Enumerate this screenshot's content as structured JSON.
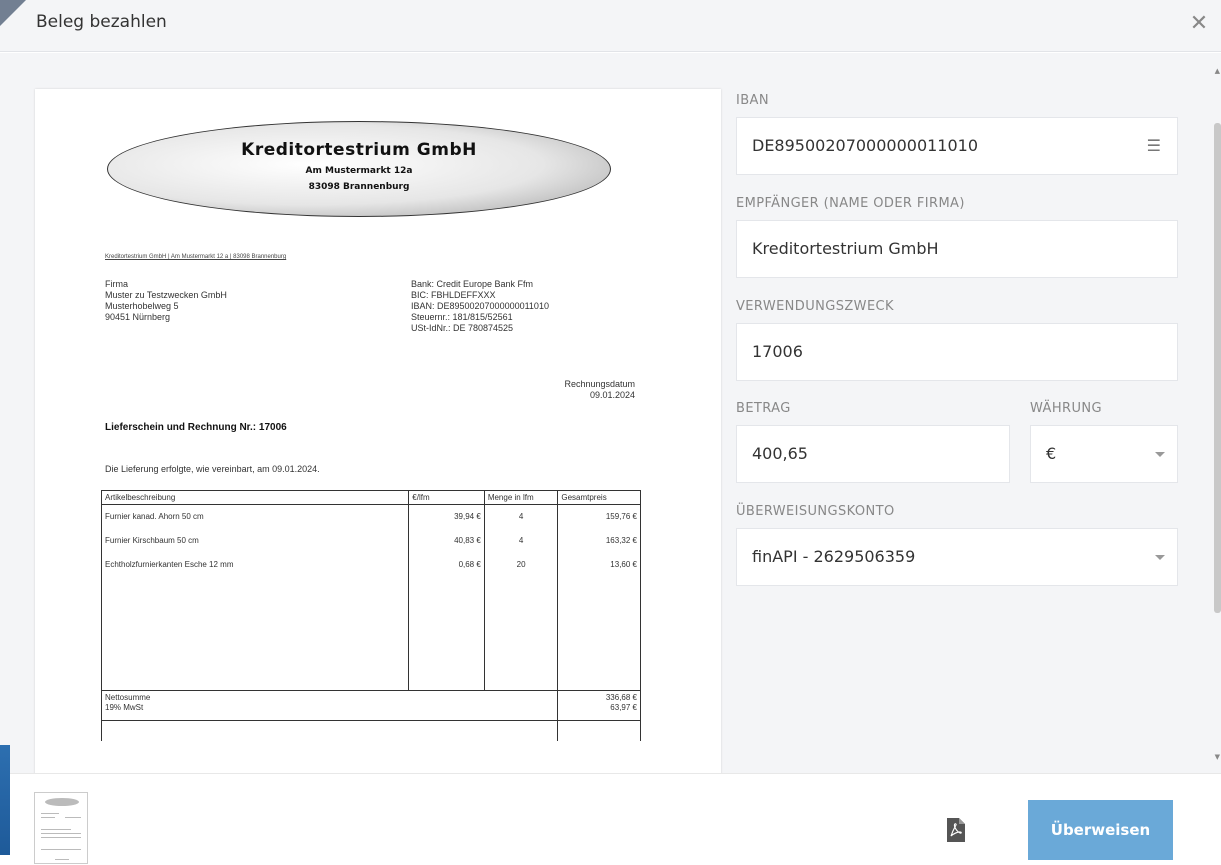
{
  "dialog": {
    "title": "Beleg bezahlen",
    "close_icon": "close-icon"
  },
  "document": {
    "logo": {
      "company": "Kreditortestrium GmbH",
      "street": "Am Mustermarkt 12a",
      "city": "83098 Brannenburg"
    },
    "sender_line": "Kreditortestrium GmbH | Am Mustermarkt 12 a | 83098 Brannenburg",
    "recipient": [
      "Firma",
      "Muster zu Testzwecken GmbH",
      "Musterhobelweg 5",
      "90451 Nürnberg"
    ],
    "bank": [
      "Bank: Credit Europe Bank Ffm",
      "BIC: FBHLDEFFXXX",
      "IBAN: DE89500207000000011010",
      "Steuernr.: 181/815/52561",
      "USt-IdNr.: DE 780874525"
    ],
    "date_label": "Rechnungsdatum",
    "date_value": "09.01.2024",
    "heading": "Lieferschein und Rechnung Nr.: 17006",
    "delivery_note": "Die Lieferung erfolgte, wie vereinbart, am 09.01.2024.",
    "table": {
      "headers": [
        "Artikelbeschreibung",
        "€/lfm",
        "Menge in lfm",
        "Gesamtpreis"
      ],
      "rows": [
        [
          "Furnier kanad. Ahorn 50 cm",
          "39,94 €",
          "4",
          "159,76 €"
        ],
        [
          "Furnier Kirschbaum 50 cm",
          "40,83 €",
          "4",
          "163,32 €"
        ],
        [
          "Echtholzfurnierkanten Esche 12 mm",
          "0,68 €",
          "20",
          "13,60 €"
        ]
      ],
      "net_label": "Nettosumme",
      "net_value": "336,68 €",
      "vat_label": "19% MwSt",
      "vat_value": "63,97 €"
    }
  },
  "form": {
    "iban": {
      "label": "IBAN",
      "value": "DE89500207000000011010",
      "icon": "list-icon"
    },
    "recipient": {
      "label": "EMPFÄNGER (NAME ODER FIRMA)",
      "value": "Kreditortestrium GmbH"
    },
    "purpose": {
      "label": "VERWENDUNGSZWECK",
      "value": "17006"
    },
    "amount": {
      "label": "BETRAG",
      "value": "400,65"
    },
    "currency": {
      "label": "WÄHRUNG",
      "value": "€"
    },
    "account": {
      "label": "ÜBERWEISUNGSKONTO",
      "value": "finAPI - 2629506359"
    }
  },
  "footer": {
    "pay_label": "Überweisen",
    "pdf_icon": "pdf-icon"
  },
  "colors": {
    "primary_button": "#6aa9d8",
    "header_bg": "#f4f5f7"
  }
}
